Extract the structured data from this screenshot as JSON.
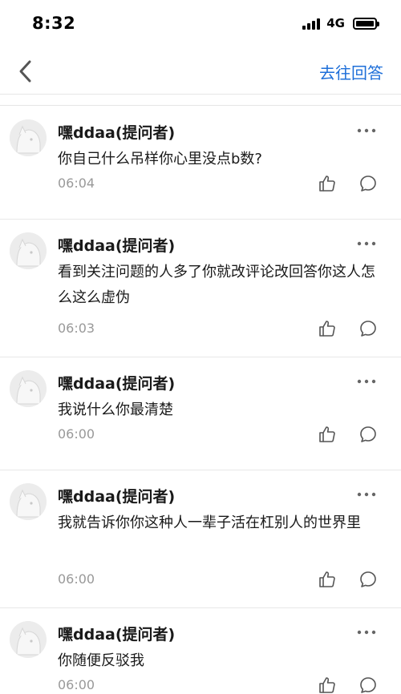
{
  "status": {
    "time": "8:32",
    "network": "4G"
  },
  "nav": {
    "action_label": "去往回答"
  },
  "comments": [
    {
      "author": "嘿ddaa(提问者)",
      "content": "你自己什么吊样你心里没点b数?",
      "time": "06:04"
    },
    {
      "author": "嘿ddaa(提问者)",
      "content": "看到关注问题的人多了你就改评论改回答你这人怎么这么虚伪",
      "time": "06:03"
    },
    {
      "author": "嘿ddaa(提问者)",
      "content": "我说什么你最清楚",
      "time": "06:00"
    },
    {
      "author": "嘿ddaa(提问者)",
      "content": "我就告诉你你这种人一辈子活在杠别人的世界里",
      "time": "06:00"
    },
    {
      "author": "嘿ddaa(提问者)",
      "content": "你随便反驳我",
      "time": "06:00"
    }
  ],
  "icons": {
    "back": "chevron-left-icon",
    "more": "more-dots-icon",
    "like": "thumb-up-icon",
    "reply": "comment-bubble-icon",
    "avatar": "default-avatar-icon"
  },
  "colors": {
    "accent": "#1e6fd9",
    "muted": "#999999",
    "divider": "#e6e6e6"
  }
}
